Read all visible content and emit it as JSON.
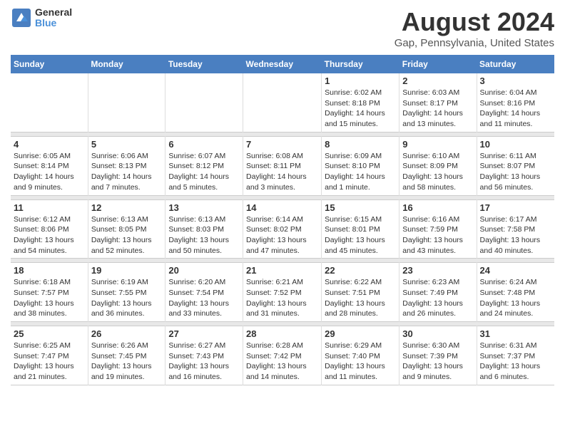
{
  "logo": {
    "general": "General",
    "blue": "Blue"
  },
  "header": {
    "title": "August 2024",
    "subtitle": "Gap, Pennsylvania, United States"
  },
  "weekdays": [
    "Sunday",
    "Monday",
    "Tuesday",
    "Wednesday",
    "Thursday",
    "Friday",
    "Saturday"
  ],
  "weeks": [
    {
      "days": [
        {
          "num": "",
          "sunrise": "",
          "sunset": "",
          "daylight": ""
        },
        {
          "num": "",
          "sunrise": "",
          "sunset": "",
          "daylight": ""
        },
        {
          "num": "",
          "sunrise": "",
          "sunset": "",
          "daylight": ""
        },
        {
          "num": "",
          "sunrise": "",
          "sunset": "",
          "daylight": ""
        },
        {
          "num": "1",
          "sunrise": "Sunrise: 6:02 AM",
          "sunset": "Sunset: 8:18 PM",
          "daylight": "Daylight: 14 hours and 15 minutes."
        },
        {
          "num": "2",
          "sunrise": "Sunrise: 6:03 AM",
          "sunset": "Sunset: 8:17 PM",
          "daylight": "Daylight: 14 hours and 13 minutes."
        },
        {
          "num": "3",
          "sunrise": "Sunrise: 6:04 AM",
          "sunset": "Sunset: 8:16 PM",
          "daylight": "Daylight: 14 hours and 11 minutes."
        }
      ]
    },
    {
      "days": [
        {
          "num": "4",
          "sunrise": "Sunrise: 6:05 AM",
          "sunset": "Sunset: 8:14 PM",
          "daylight": "Daylight: 14 hours and 9 minutes."
        },
        {
          "num": "5",
          "sunrise": "Sunrise: 6:06 AM",
          "sunset": "Sunset: 8:13 PM",
          "daylight": "Daylight: 14 hours and 7 minutes."
        },
        {
          "num": "6",
          "sunrise": "Sunrise: 6:07 AM",
          "sunset": "Sunset: 8:12 PM",
          "daylight": "Daylight: 14 hours and 5 minutes."
        },
        {
          "num": "7",
          "sunrise": "Sunrise: 6:08 AM",
          "sunset": "Sunset: 8:11 PM",
          "daylight": "Daylight: 14 hours and 3 minutes."
        },
        {
          "num": "8",
          "sunrise": "Sunrise: 6:09 AM",
          "sunset": "Sunset: 8:10 PM",
          "daylight": "Daylight: 14 hours and 1 minute."
        },
        {
          "num": "9",
          "sunrise": "Sunrise: 6:10 AM",
          "sunset": "Sunset: 8:09 PM",
          "daylight": "Daylight: 13 hours and 58 minutes."
        },
        {
          "num": "10",
          "sunrise": "Sunrise: 6:11 AM",
          "sunset": "Sunset: 8:07 PM",
          "daylight": "Daylight: 13 hours and 56 minutes."
        }
      ]
    },
    {
      "days": [
        {
          "num": "11",
          "sunrise": "Sunrise: 6:12 AM",
          "sunset": "Sunset: 8:06 PM",
          "daylight": "Daylight: 13 hours and 54 minutes."
        },
        {
          "num": "12",
          "sunrise": "Sunrise: 6:13 AM",
          "sunset": "Sunset: 8:05 PM",
          "daylight": "Daylight: 13 hours and 52 minutes."
        },
        {
          "num": "13",
          "sunrise": "Sunrise: 6:13 AM",
          "sunset": "Sunset: 8:03 PM",
          "daylight": "Daylight: 13 hours and 50 minutes."
        },
        {
          "num": "14",
          "sunrise": "Sunrise: 6:14 AM",
          "sunset": "Sunset: 8:02 PM",
          "daylight": "Daylight: 13 hours and 47 minutes."
        },
        {
          "num": "15",
          "sunrise": "Sunrise: 6:15 AM",
          "sunset": "Sunset: 8:01 PM",
          "daylight": "Daylight: 13 hours and 45 minutes."
        },
        {
          "num": "16",
          "sunrise": "Sunrise: 6:16 AM",
          "sunset": "Sunset: 7:59 PM",
          "daylight": "Daylight: 13 hours and 43 minutes."
        },
        {
          "num": "17",
          "sunrise": "Sunrise: 6:17 AM",
          "sunset": "Sunset: 7:58 PM",
          "daylight": "Daylight: 13 hours and 40 minutes."
        }
      ]
    },
    {
      "days": [
        {
          "num": "18",
          "sunrise": "Sunrise: 6:18 AM",
          "sunset": "Sunset: 7:57 PM",
          "daylight": "Daylight: 13 hours and 38 minutes."
        },
        {
          "num": "19",
          "sunrise": "Sunrise: 6:19 AM",
          "sunset": "Sunset: 7:55 PM",
          "daylight": "Daylight: 13 hours and 36 minutes."
        },
        {
          "num": "20",
          "sunrise": "Sunrise: 6:20 AM",
          "sunset": "Sunset: 7:54 PM",
          "daylight": "Daylight: 13 hours and 33 minutes."
        },
        {
          "num": "21",
          "sunrise": "Sunrise: 6:21 AM",
          "sunset": "Sunset: 7:52 PM",
          "daylight": "Daylight: 13 hours and 31 minutes."
        },
        {
          "num": "22",
          "sunrise": "Sunrise: 6:22 AM",
          "sunset": "Sunset: 7:51 PM",
          "daylight": "Daylight: 13 hours and 28 minutes."
        },
        {
          "num": "23",
          "sunrise": "Sunrise: 6:23 AM",
          "sunset": "Sunset: 7:49 PM",
          "daylight": "Daylight: 13 hours and 26 minutes."
        },
        {
          "num": "24",
          "sunrise": "Sunrise: 6:24 AM",
          "sunset": "Sunset: 7:48 PM",
          "daylight": "Daylight: 13 hours and 24 minutes."
        }
      ]
    },
    {
      "days": [
        {
          "num": "25",
          "sunrise": "Sunrise: 6:25 AM",
          "sunset": "Sunset: 7:47 PM",
          "daylight": "Daylight: 13 hours and 21 minutes."
        },
        {
          "num": "26",
          "sunrise": "Sunrise: 6:26 AM",
          "sunset": "Sunset: 7:45 PM",
          "daylight": "Daylight: 13 hours and 19 minutes."
        },
        {
          "num": "27",
          "sunrise": "Sunrise: 6:27 AM",
          "sunset": "Sunset: 7:43 PM",
          "daylight": "Daylight: 13 hours and 16 minutes."
        },
        {
          "num": "28",
          "sunrise": "Sunrise: 6:28 AM",
          "sunset": "Sunset: 7:42 PM",
          "daylight": "Daylight: 13 hours and 14 minutes."
        },
        {
          "num": "29",
          "sunrise": "Sunrise: 6:29 AM",
          "sunset": "Sunset: 7:40 PM",
          "daylight": "Daylight: 13 hours and 11 minutes."
        },
        {
          "num": "30",
          "sunrise": "Sunrise: 6:30 AM",
          "sunset": "Sunset: 7:39 PM",
          "daylight": "Daylight: 13 hours and 9 minutes."
        },
        {
          "num": "31",
          "sunrise": "Sunrise: 6:31 AM",
          "sunset": "Sunset: 7:37 PM",
          "daylight": "Daylight: 13 hours and 6 minutes."
        }
      ]
    }
  ]
}
